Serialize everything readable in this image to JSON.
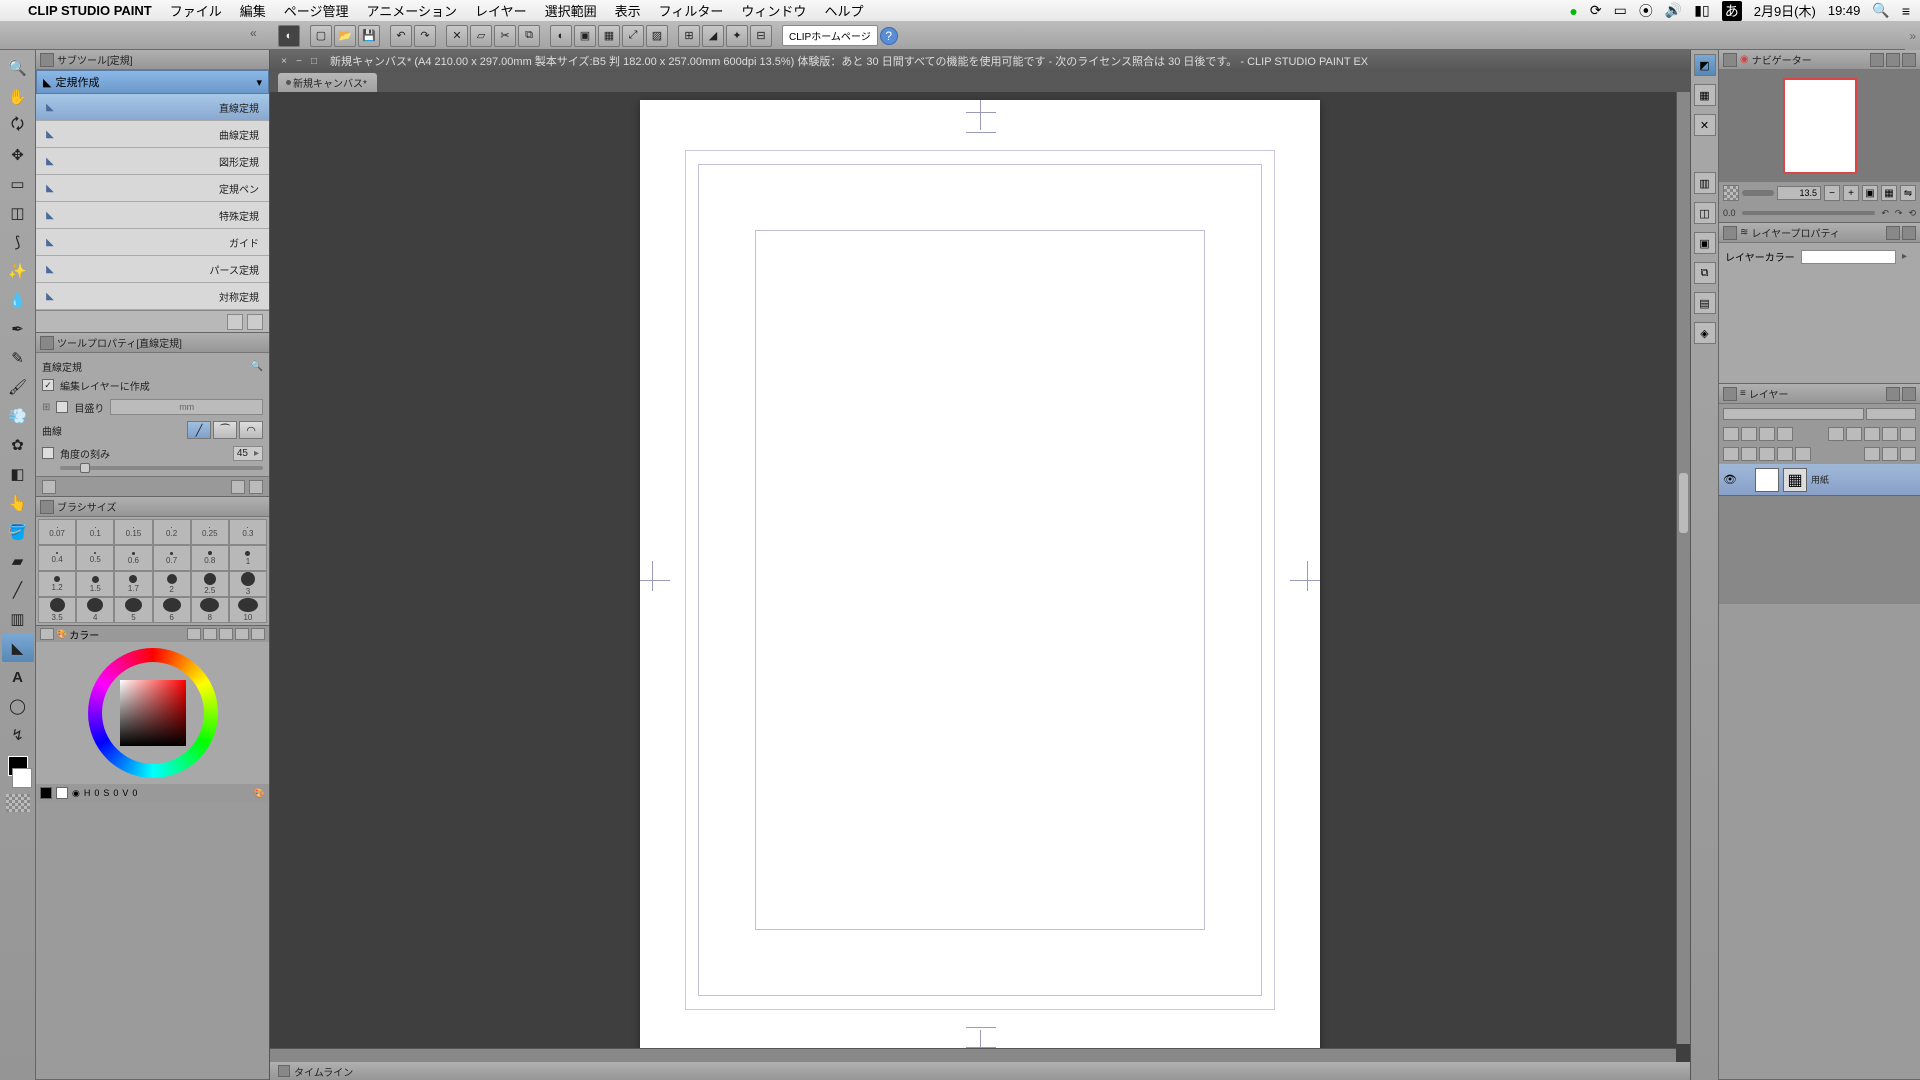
{
  "menubar": {
    "app": "CLIP STUDIO PAINT",
    "items": [
      "ファイル",
      "編集",
      "ページ管理",
      "アニメーション",
      "レイヤー",
      "選択範囲",
      "表示",
      "フィルター",
      "ウィンドウ",
      "ヘルプ"
    ],
    "status": {
      "ime": "あ",
      "date": "2月9日(木)",
      "time": "19:49"
    }
  },
  "toolbar": {
    "clip_home": "CLIPホームページ"
  },
  "doc": {
    "title": "新規キャンバス* (A4 210.00 x 297.00mm 製本サイズ:B5 判 182.00 x 257.00mm 600dpi 13.5%)  体験版：あと 30 日間すべての機能を使用可能です - 次のライセンス照合は 30 日後です。 - CLIP STUDIO PAINT EX",
    "tab": "新規キャンバス*"
  },
  "subtool": {
    "header": "サブツール[定規]",
    "selected": "定規作成",
    "items": [
      "直線定規",
      "曲線定規",
      "図形定規",
      "定規ペン",
      "特殊定規",
      "ガイド",
      "パース定規",
      "対称定規"
    ]
  },
  "property": {
    "header": "ツールプロパティ[直線定規]",
    "name": "直線定規",
    "edit_layer": "編集レイヤーに作成",
    "scale": "目盛り",
    "unit": "mm",
    "curve": "曲線",
    "angle_step": "角度の刻み",
    "angle_val": "45"
  },
  "brush": {
    "header": "ブラシサイズ",
    "sizes_row1": [
      "0.07",
      "0.1",
      "0.15",
      "0.2",
      "0.25",
      "0.3"
    ],
    "sizes_row2": [
      "0.4",
      "0.5",
      "0.6",
      "0.7",
      "0.8",
      "1"
    ],
    "sizes_row3": [
      "1.2",
      "1.5",
      "1.7",
      "2",
      "2.5",
      "3"
    ],
    "sizes_row4": [
      "3.5",
      "4",
      "5",
      "6",
      "8",
      "10"
    ]
  },
  "color": {
    "header": "カラー",
    "footer_h": "H",
    "footer_s": "S",
    "footer_v": "V",
    "h": "0",
    "s": "0",
    "v": "0"
  },
  "navigator": {
    "header": "ナビゲーター",
    "zoom": "13.5",
    "rot": "0.0"
  },
  "layerprop": {
    "header": "レイヤープロパティ",
    "layercolor": "レイヤーカラー"
  },
  "layers": {
    "header": "レイヤー",
    "paper": "用紙"
  },
  "timeline": {
    "header": "タイムライン"
  }
}
